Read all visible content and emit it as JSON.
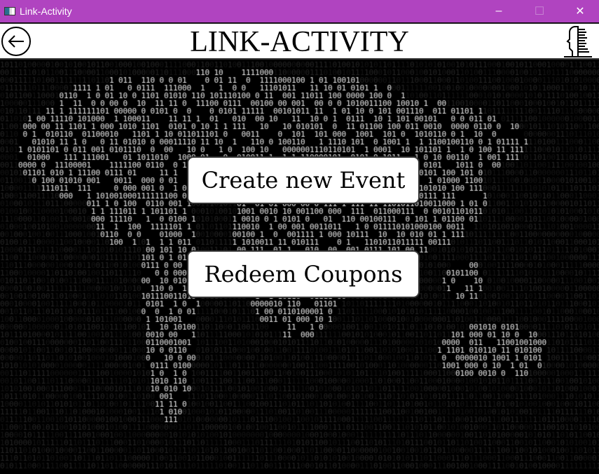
{
  "window": {
    "title": "Link-Activity",
    "minimize": "–",
    "maximize": "☐",
    "close": "✕"
  },
  "header": {
    "title": "LINK-ACTIVITY",
    "back_icon": "arrow-left-circle-icon",
    "profile_icon": "profile-head-icon"
  },
  "buttons": {
    "create_event": "Create new Event",
    "redeem_coupons": "Redeem Coupons"
  },
  "colors": {
    "titlebar": "#b044c0",
    "background": "#000000"
  }
}
